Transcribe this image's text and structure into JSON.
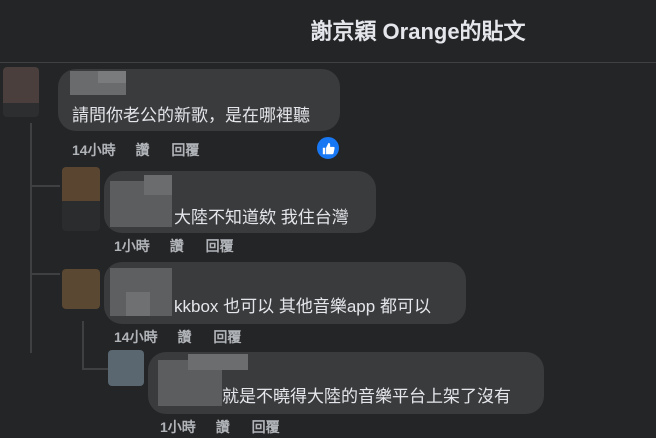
{
  "page": {
    "title": "謝京穎 Orange的貼文"
  },
  "comments": [
    {
      "text": "請問你老公的新歌，是在哪裡聽",
      "time": "14小時",
      "like": "讚",
      "reply": "回覆"
    },
    {
      "text": "大陸不知道欸 我住台灣",
      "time": "1小時",
      "like": "讚",
      "reply": "回覆"
    },
    {
      "text": "kkbox 也可以 其他音樂app 都可以",
      "time": "14小時",
      "like": "讚",
      "reply": "回覆"
    },
    {
      "text": "就是不曉得大陸的音樂平台上架了沒有",
      "time": "1小時",
      "like": "讚",
      "reply": "回覆"
    }
  ],
  "icons": {
    "reaction": "thumbs-up-icon"
  },
  "colors": {
    "background": "#242526",
    "bubble": "#3a3b3c",
    "accent": "#1877f2"
  }
}
